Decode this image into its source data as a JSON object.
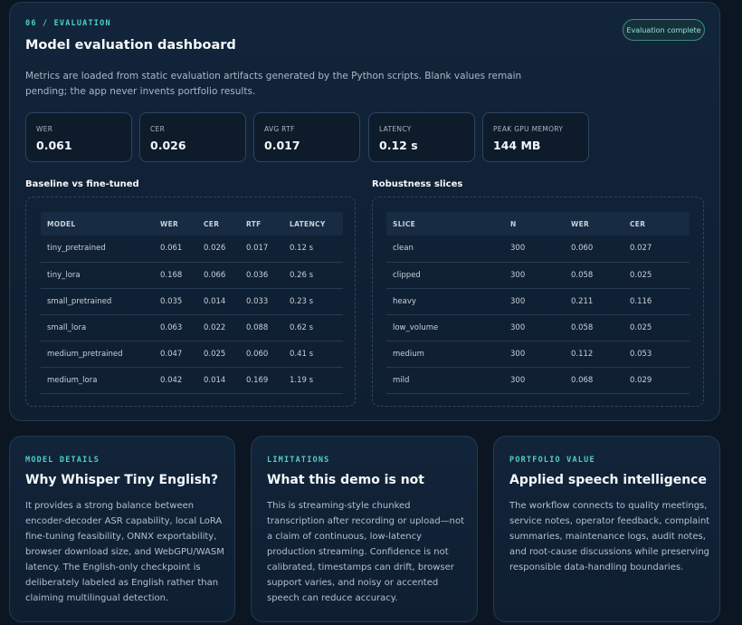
{
  "header": {
    "eyebrow": "06 / EVALUATION",
    "title": "Model evaluation dashboard",
    "description": "Metrics are loaded from static evaluation artifacts generated by the Python scripts. Blank values remain pending; the app never invents portfolio results.",
    "status_badge": "Evaluation complete"
  },
  "metrics": [
    {
      "label": "WER",
      "value": "0.061"
    },
    {
      "label": "CER",
      "value": "0.026"
    },
    {
      "label": "AVG RTF",
      "value": "0.017"
    },
    {
      "label": "LATENCY",
      "value": "0.12 s"
    },
    {
      "label": "PEAK GPU MEMORY",
      "value": "144 MB"
    }
  ],
  "baseline_table": {
    "title": "Baseline vs fine-tuned",
    "columns": [
      "MODEL",
      "WER",
      "CER",
      "RTF",
      "LATENCY"
    ],
    "rows": [
      [
        "tiny_pretrained",
        "0.061",
        "0.026",
        "0.017",
        "0.12 s"
      ],
      [
        "tiny_lora",
        "0.168",
        "0.066",
        "0.036",
        "0.26 s"
      ],
      [
        "small_pretrained",
        "0.035",
        "0.014",
        "0.033",
        "0.23 s"
      ],
      [
        "small_lora",
        "0.063",
        "0.022",
        "0.088",
        "0.62 s"
      ],
      [
        "medium_pretrained",
        "0.047",
        "0.025",
        "0.060",
        "0.41 s"
      ],
      [
        "medium_lora",
        "0.042",
        "0.014",
        "0.169",
        "1.19 s"
      ]
    ]
  },
  "robustness_table": {
    "title": "Robustness slices",
    "columns": [
      "SLICE",
      "N",
      "WER",
      "CER"
    ],
    "rows": [
      [
        "clean",
        "300",
        "0.060",
        "0.027"
      ],
      [
        "clipped",
        "300",
        "0.058",
        "0.025"
      ],
      [
        "heavy",
        "300",
        "0.211",
        "0.116"
      ],
      [
        "low_volume",
        "300",
        "0.058",
        "0.025"
      ],
      [
        "medium",
        "300",
        "0.112",
        "0.053"
      ],
      [
        "mild",
        "300",
        "0.068",
        "0.029"
      ]
    ]
  },
  "cards": [
    {
      "eyebrow": "MODEL DETAILS",
      "title": "Why Whisper Tiny English?",
      "body": "It provides a strong balance between encoder-decoder ASR capability, local LoRA fine-tuning feasibility, ONNX exportability, browser download size, and WebGPU/WASM latency. The English-only checkpoint is deliberately labeled as English rather than claiming multilingual detection."
    },
    {
      "eyebrow": "LIMITATIONS",
      "title": "What this demo is not",
      "body": "This is streaming-style chunked transcription after recording or upload—not a claim of continuous, low-latency production streaming. Confidence is not calibrated, timestamps can drift, browser support varies, and noisy or accented speech can reduce accuracy."
    },
    {
      "eyebrow": "PORTFOLIO VALUE",
      "title": "Applied speech intelligence",
      "body": "The workflow connects to quality meetings, service notes, operator feedback, complaint summaries, maintenance logs, audit notes, and root-cause discussions while preserving responsible data-handling boundaries."
    }
  ],
  "colors": {
    "accent": "#4fd1c5",
    "background": "#0b1622",
    "panel": "#12243a"
  }
}
